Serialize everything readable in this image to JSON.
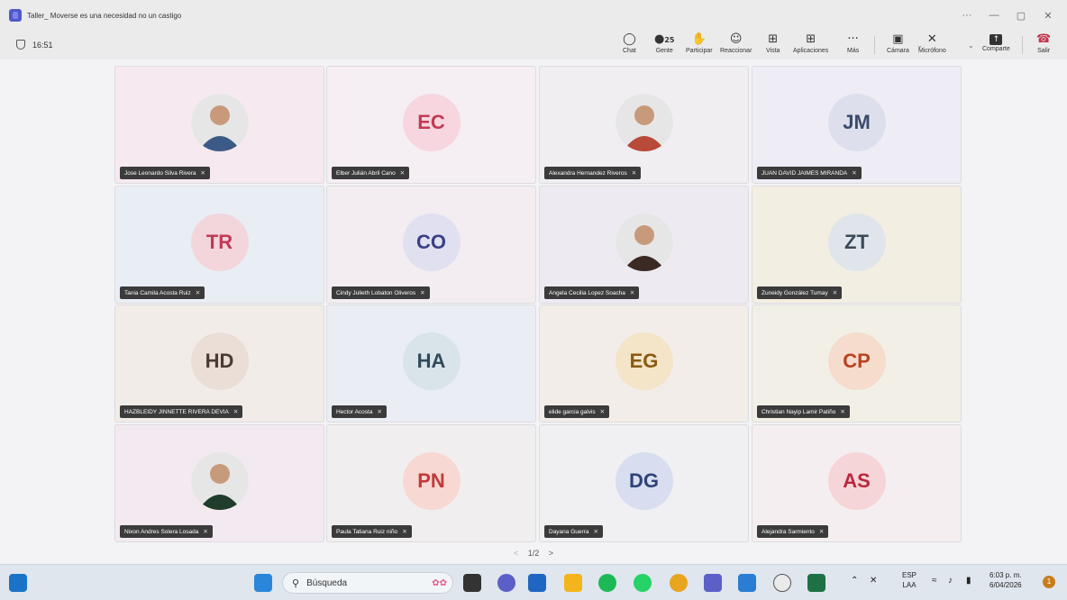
{
  "window": {
    "title": "Taller_ Moverse es una necesidad no un castigo",
    "controls": [
      "···",
      "—",
      "▢",
      "✕"
    ]
  },
  "meeting": {
    "timer": "16:51",
    "people_count": "25",
    "toolbar": {
      "chat": "Chat",
      "people": "Gente",
      "raise": "Participar",
      "react": "Reaccionar",
      "view": "Vista",
      "apps": "Aplicaciones",
      "more": "Más",
      "camera": "Cámara",
      "mic": "Micrófono",
      "share": "Comparte",
      "leave": "Salir"
    }
  },
  "participants": [
    {
      "name": "Jose Leonardo Silva Rivera",
      "initials": "",
      "photo": true,
      "photo_tone": "#3c5a86",
      "bg": "#f6e9f0",
      "badge": "📶",
      "color": ""
    },
    {
      "name": "Elber Julián Abril Cano",
      "initials": "EC",
      "photo": false,
      "bg": "#f5eef2",
      "color": "#c23a55",
      "avatar_bg": "#f7d6df"
    },
    {
      "name": "Alexandra Hernandez Riveros",
      "initials": "",
      "photo": true,
      "photo_tone": "#b84a3a",
      "bg": "#f1eef2",
      "color": ""
    },
    {
      "name": "JUAN DAVID JAIMES MIRANDA",
      "initials": "JM",
      "photo": false,
      "bg": "#eeedf5",
      "color": "#3a4a6a",
      "avatar_bg": "#dde0ec"
    },
    {
      "name": "Tania Camila Acosta Ruiz",
      "initials": "TR",
      "photo": false,
      "bg": "#e9eef5",
      "color": "#c23a55",
      "avatar_bg": "#f3d5dc"
    },
    {
      "name": "Cindy Julieth Lobaton Oliveros",
      "initials": "CO",
      "photo": false,
      "bg": "#f3ecf1",
      "color": "#3b3f88",
      "avatar_bg": "#e1e0f0"
    },
    {
      "name": "Angela Cecilia Lopez Soacha",
      "initials": "",
      "photo": true,
      "photo_tone": "#3b2a24",
      "bg": "#eeeaf2",
      "color": ""
    },
    {
      "name": "Zuneidy González Tumay",
      "initials": "ZT",
      "photo": false,
      "bg": "#f3eee2",
      "color": "#3a4a5a",
      "avatar_bg": "#dfe5ea"
    },
    {
      "name": "HAZBLEIDY JINNETTE RIVERA DEVIA",
      "initials": "HD",
      "photo": false,
      "bg": "#f2ece9",
      "color": "#4a3b35",
      "avatar_bg": "#eaded7"
    },
    {
      "name": "Hector Acosta",
      "initials": "HA",
      "photo": false,
      "bg": "#eaeef4",
      "color": "#2f4a5a",
      "avatar_bg": "#d9e4ea"
    },
    {
      "name": "elide garcia galvis",
      "initials": "EG",
      "photo": false,
      "bg": "#f3ede9",
      "color": "#8a5a10",
      "avatar_bg": "#f4e4c8"
    },
    {
      "name": "Christian Nayip Lamir Patiño",
      "initials": "CP",
      "photo": false,
      "bg": "#f2f0e6",
      "color": "#b8421f",
      "avatar_bg": "#f5dccd"
    },
    {
      "name": "Nixon Andres Solera Losada",
      "initials": "",
      "photo": true,
      "photo_tone": "#1f3d2a",
      "bg": "#f3e9f0",
      "color": ""
    },
    {
      "name": "Paula Tatiana Ruiz niño",
      "initials": "PN",
      "photo": false,
      "bg": "#f1eef0",
      "color": "#c23a3a",
      "avatar_bg": "#f8d8d3"
    },
    {
      "name": "Dayana Guerra",
      "initials": "DG",
      "photo": false,
      "bg": "#f0f0f2",
      "color": "#2e4378",
      "avatar_bg": "#d8def0"
    },
    {
      "name": "Alejandra Sarmiento",
      "initials": "AS",
      "photo": false,
      "bg": "#f4eef0",
      "color": "#b8283b",
      "avatar_bg": "#f6d5d8"
    }
  ],
  "pager": {
    "prev": "<",
    "label": "1/2",
    "next": ">"
  },
  "taskbar": {
    "search_placeholder": "Búsqueda",
    "lang_top": "ESP",
    "lang_bottom": "LAA",
    "time": "6:03 p. m.",
    "date": "6/04/2026",
    "notif_count": "1"
  }
}
